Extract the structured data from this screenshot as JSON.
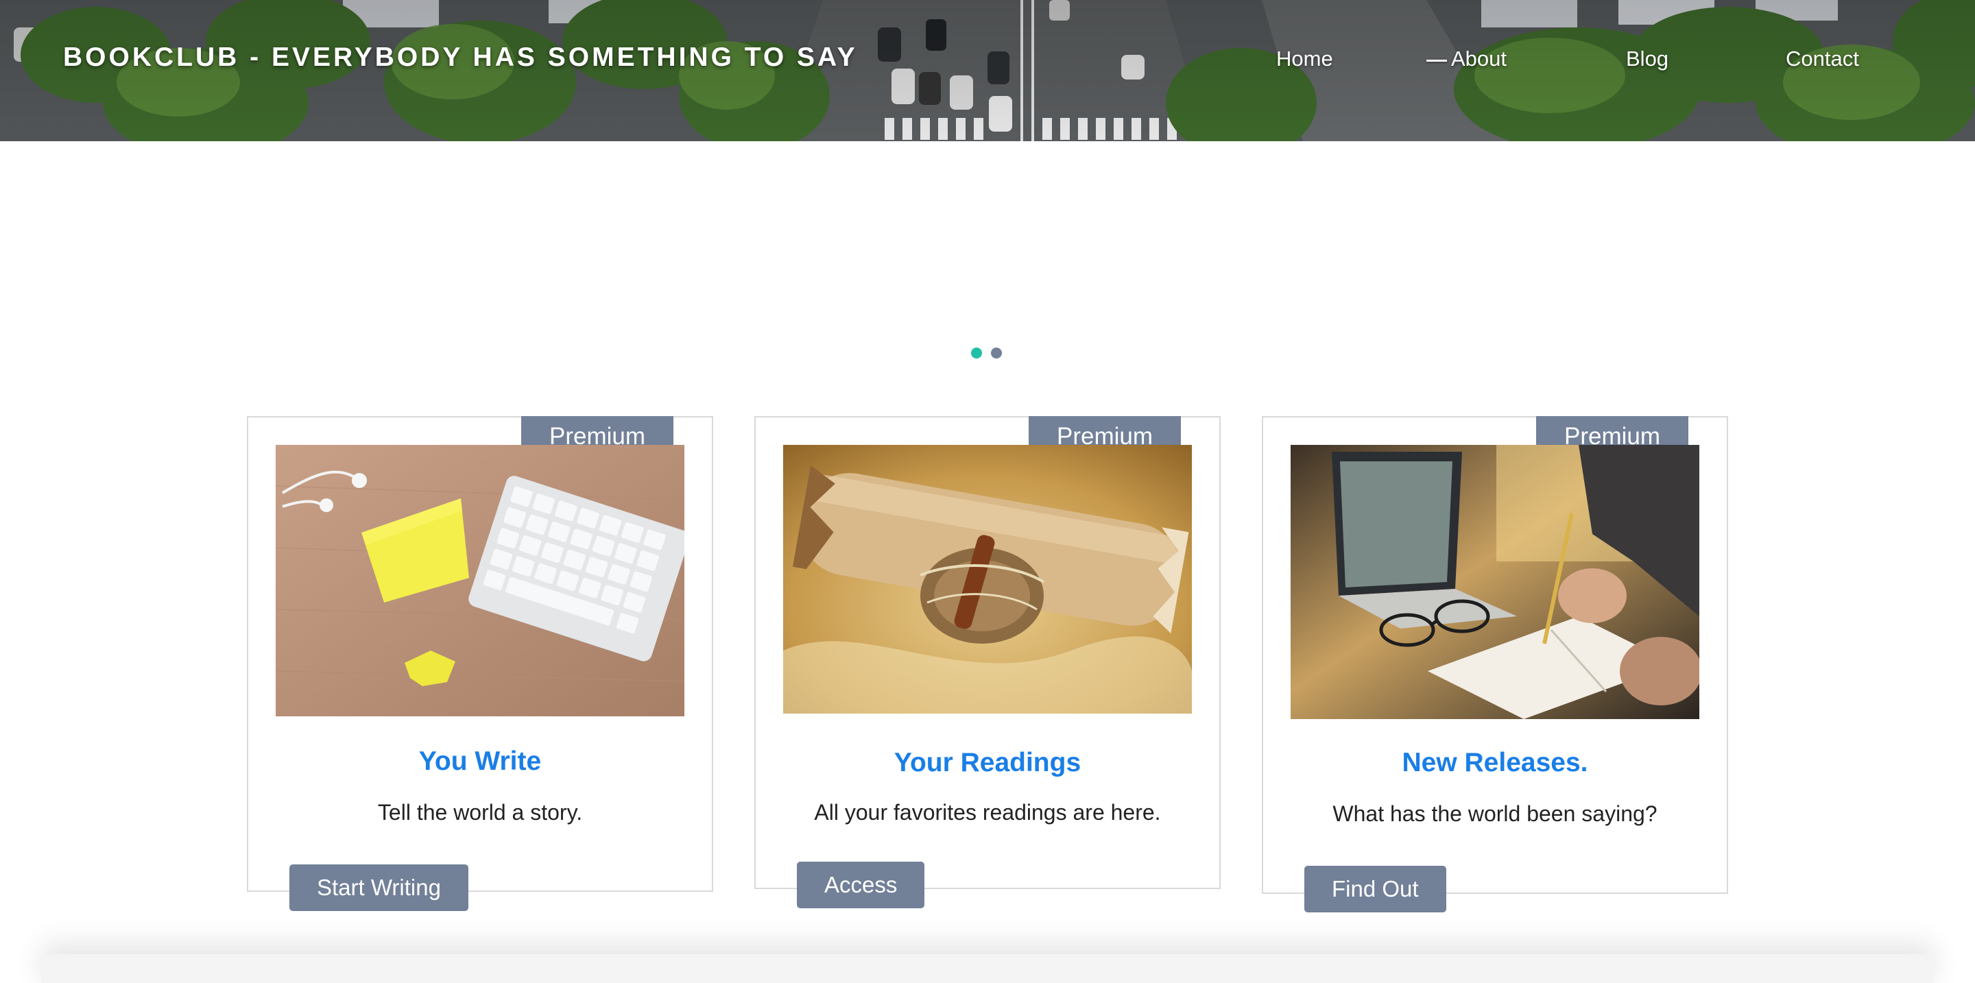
{
  "header": {
    "brand": "BOOKCLUB - EVERYBODY HAS SOMETHING TO SAY",
    "nav": [
      {
        "label": "Home"
      },
      {
        "label": "About"
      },
      {
        "label": "Blog"
      },
      {
        "label": "Contact"
      }
    ],
    "background_image": "aerial-city-street"
  },
  "carousel": {
    "slide_count": 2,
    "active_index": 0,
    "active_color": "#1fbfa6",
    "inactive_color": "#728098"
  },
  "colors": {
    "accent_title": "#1a7ee6",
    "button_bg": "#728098",
    "badge_bg": "#728098"
  },
  "cards": [
    {
      "badge": "Premium",
      "image": "desk-keyboard-sticky-note",
      "title": "You Write",
      "text": "Tell the world a story.",
      "button": "Start Writing"
    },
    {
      "badge": "Premium",
      "image": "rolled-parchment-scroll",
      "title": "Your Readings",
      "text": "All your favorites readings are here.",
      "button": "Access"
    },
    {
      "badge": "Premium",
      "image": "person-writing-notebook-laptop",
      "title": "New Releases.",
      "text": "What has the world been saying?",
      "button": "Find Out"
    }
  ]
}
